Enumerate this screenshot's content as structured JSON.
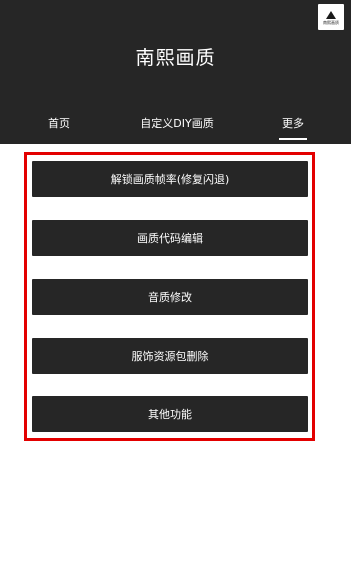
{
  "header": {
    "title": "南熙画质",
    "logo_text": "南熙画质"
  },
  "tabs": [
    {
      "label": "首页"
    },
    {
      "label": "自定义DIY画质"
    },
    {
      "label": "更多",
      "active": true
    }
  ],
  "menu": {
    "items": [
      {
        "label": "解锁画质帧率(修复闪退)"
      },
      {
        "label": "画质代码编辑"
      },
      {
        "label": "音质修改"
      },
      {
        "label": "服饰资源包删除"
      },
      {
        "label": "其他功能"
      }
    ]
  },
  "colors": {
    "header_bg": "#262626",
    "button_bg": "#262626",
    "highlight_border": "#e30000",
    "page_bg": "#ffffff"
  }
}
